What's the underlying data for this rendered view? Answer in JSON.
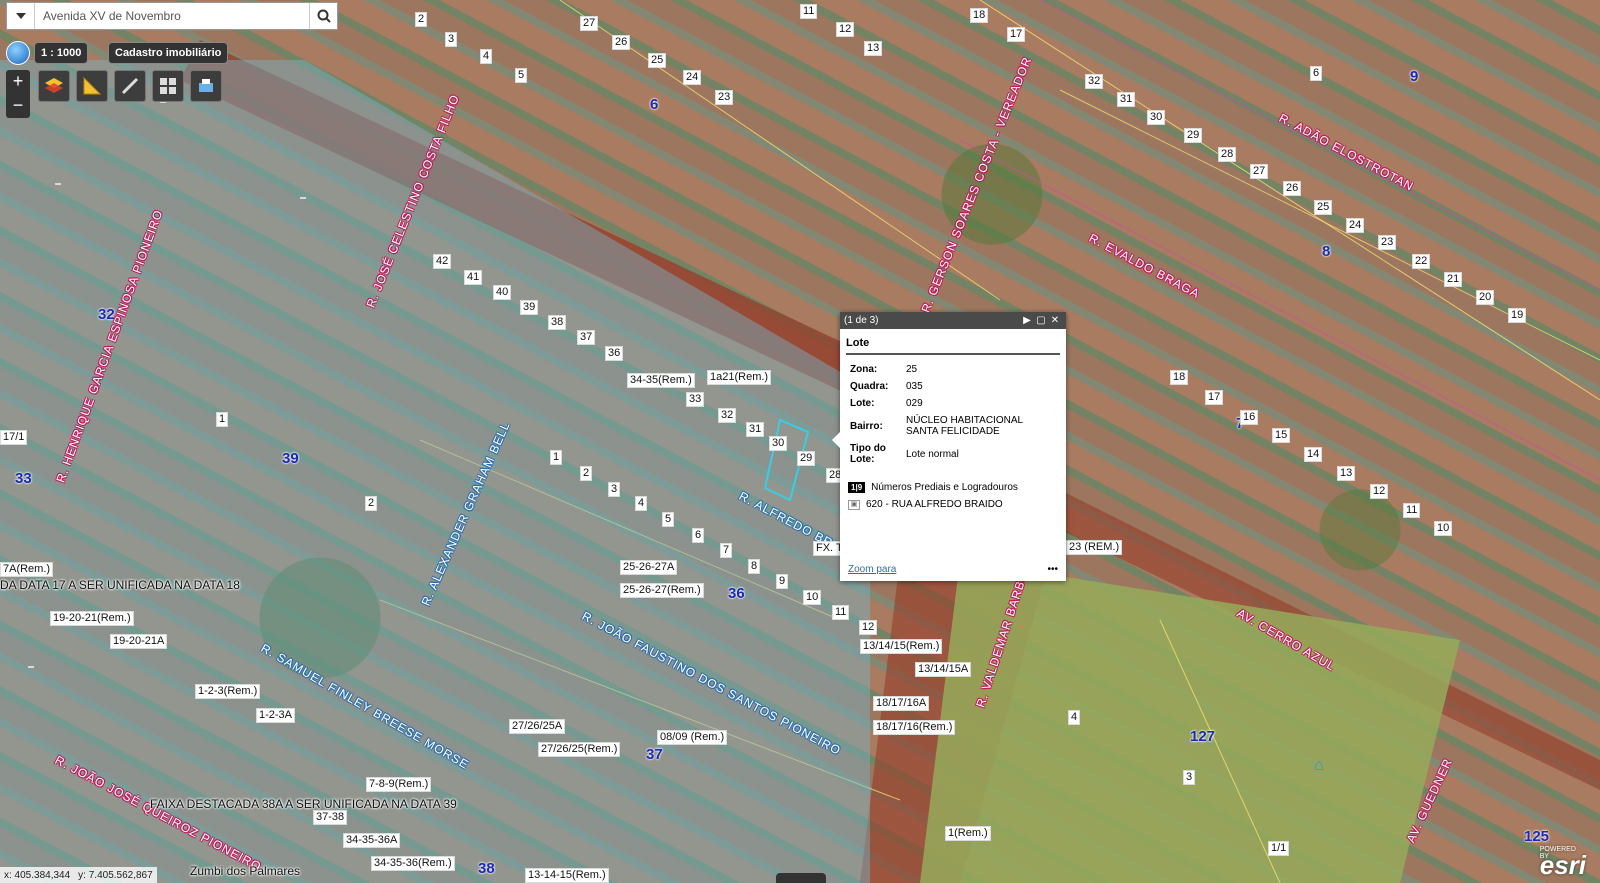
{
  "search": {
    "value": "Avenida XV de Novembro",
    "placeholder": "Avenida XV de Novembro"
  },
  "scale": {
    "label": "1 : 1000"
  },
  "layer_selector": {
    "label": "Cadastro imobiliário"
  },
  "zoom": {
    "in": "+",
    "out": "−"
  },
  "toolbar": {
    "items": [
      {
        "icon": "layers-icon"
      },
      {
        "icon": "measure-icon"
      },
      {
        "icon": "draw-icon"
      },
      {
        "icon": "basemap-grid-icon"
      },
      {
        "icon": "print-icon"
      }
    ]
  },
  "popup": {
    "page_counter": "(1 de 3)",
    "title": "Lote",
    "fields": [
      {
        "key": "Zona:",
        "value": "25"
      },
      {
        "key": "Quadra:",
        "value": "035"
      },
      {
        "key": "Lote:",
        "value": "029"
      },
      {
        "key": "Bairro:",
        "value": "NÚCLEO HABITACIONAL SANTA FELICIDADE"
      },
      {
        "key": "Tipo do Lote:",
        "value": "Lote normal"
      }
    ],
    "related_badge": "1|9",
    "related_title": "Números Prediais e Logradouros",
    "related_item": "620 - RUA ALFREDO BRAIDO",
    "zoom_link": "Zoom para",
    "more": "•••"
  },
  "coordinates": {
    "x": "x: 405.384,344",
    "y": "y: 7.405.562,867"
  },
  "attribution": {
    "powered": "POWERED BY",
    "brand": "esri"
  },
  "streets": [
    "R. JOSÉ CELESTINO COSTA FILHO",
    "R. HENRIQUE GARCIA ESPINOSA PIONEIRO",
    "R. GERSON SOARES COSTA - VEREADOR",
    "R. ADÃO ELOSTROTAN",
    "R. EVALDO BRAGA",
    "R. ALFREDO BRAIDO",
    "R. ALEXANDER GRAHAM BELL",
    "R. JOÃO FAUSTINO DOS SANTOS PIONEIRO",
    "R. SAMUEL FINLEY BREESE MORSE",
    "R. VALDEMAR BARBOSA",
    "AV. CERRO AZUL",
    "AV. GUEDNER",
    "R. JOÃO JOSÉ QUEIROZ PIONEIRO"
  ],
  "quadras": [
    "6",
    "9",
    "8",
    "32",
    "39",
    "7",
    "33",
    "36",
    "127",
    "37",
    "38",
    "125"
  ],
  "lot_labels": [
    "2",
    "27",
    "11",
    "18",
    "3",
    "4",
    "26",
    "12",
    "13",
    "17",
    "6",
    "25",
    "23",
    "24",
    "5",
    "3",
    "4",
    "5",
    "6",
    "7",
    "8",
    "9",
    "10",
    "42",
    "41",
    "40",
    "39",
    "38",
    "37",
    "36",
    "34-35(Rem.)",
    "1a21(Rem.)",
    "33",
    "32",
    "31",
    "30",
    "29",
    "28",
    "1",
    "2",
    "3",
    "4",
    "5",
    "6",
    "7",
    "8",
    "9",
    "10",
    "11",
    "12",
    "13/14/15(Rem.)",
    "13/14/15A",
    "18/17/16A",
    "18/17/16(Rem.)",
    "25-26-27A",
    "25-26-27(Rem.)",
    "19-20-21(Rem.)",
    "19-20-21A",
    "1-2-3(Rem.)",
    "1-2-3A",
    "7-8-9(Rem.)",
    "37-38",
    "34-35-36A",
    "34-35-36(Rem.)",
    "27/26/25A",
    "27/26/25(Rem.)",
    "08/09 (Rem.)",
    "13-14-15(Rem.)",
    "23 (REM.)",
    "FX. T",
    "1(Rem.)",
    "1/1",
    "3",
    "4",
    "31",
    "32",
    "30",
    "29",
    "28",
    "27",
    "26",
    "25",
    "24",
    "23",
    "22",
    "21",
    "20",
    "19",
    "18",
    "17",
    "16",
    "15",
    "14",
    "13",
    "12",
    "11",
    "10"
  ],
  "annotations": {
    "faixa_38a": "FAIXA DESTACADA 38A A SER UNIFICADA NA DATA 39",
    "faixa_17a": "DA DATA 17 A SER UNIFICADA NA DATA 18",
    "rem_7a": "7A(Rem.)",
    "rem_17_1": "17/1",
    "bairro_zumbi": "Zumbi dos Palmares"
  }
}
